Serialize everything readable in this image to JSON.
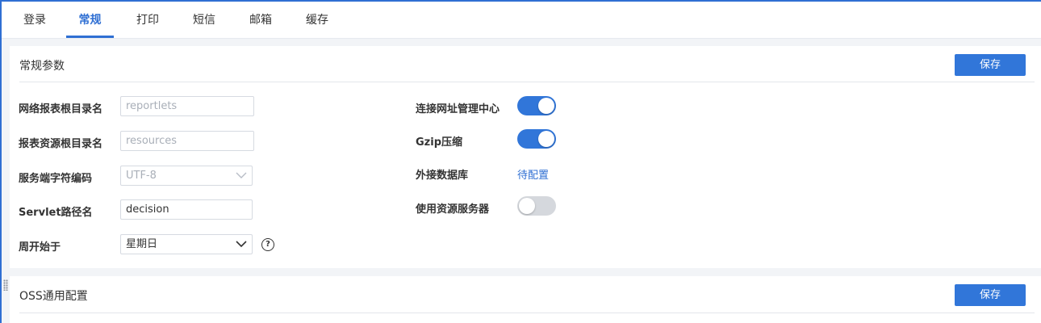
{
  "tabs": [
    {
      "label": "登录"
    },
    {
      "label": "常规"
    },
    {
      "label": "打印"
    },
    {
      "label": "短信"
    },
    {
      "label": "邮箱"
    },
    {
      "label": "缓存"
    }
  ],
  "active_tab": "常规",
  "general": {
    "title": "常规参数",
    "save_label": "保存",
    "report_root": {
      "label": "网络报表根目录名",
      "placeholder": "reportlets"
    },
    "resource_root": {
      "label": "报表资源根目录名",
      "placeholder": "resources"
    },
    "encoding": {
      "label": "服务端字符编码",
      "value": "UTF-8"
    },
    "servlet": {
      "label": "Servlet路径名",
      "value": "decision"
    },
    "week_start": {
      "label": "周开始于",
      "value": "星期日"
    },
    "connect_center": {
      "label": "连接网址管理中心",
      "on": true
    },
    "gzip": {
      "label": "Gzip压缩",
      "on": true
    },
    "external_db": {
      "label": "外接数据库",
      "link": "待配置"
    },
    "resource_server": {
      "label": "使用资源服务器",
      "on": false
    }
  },
  "oss": {
    "title": "OSS通用配置",
    "save_label": "保存"
  },
  "colors": {
    "accent": "#3176d9",
    "toggle_off": "#d5d8dd"
  }
}
